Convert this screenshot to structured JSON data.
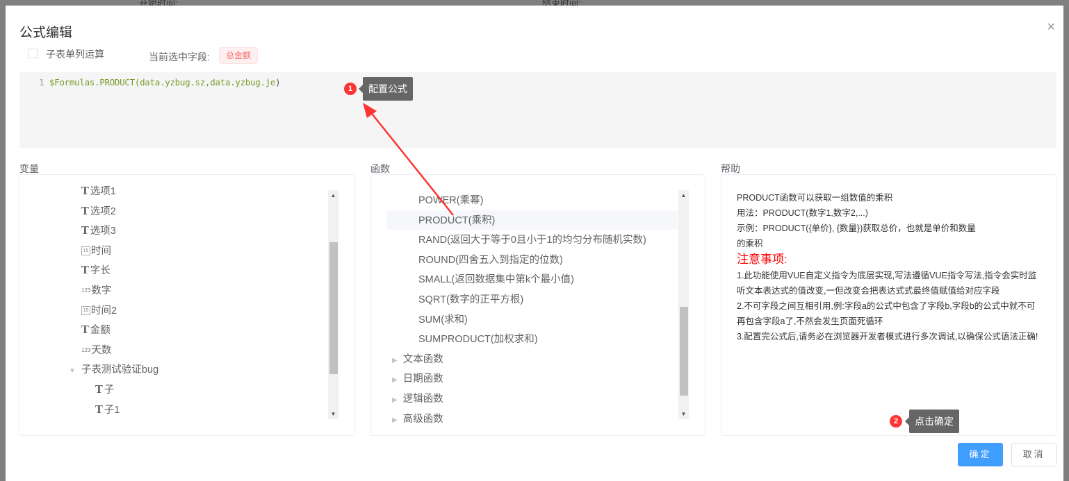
{
  "background": {
    "start_label": "开始时间:",
    "end_label": "结束时间:"
  },
  "dialog": {
    "title": "公式编辑",
    "close": "×",
    "subtable_checkbox_label": "子表单列运算",
    "current_field_label": "当前选中字段:",
    "current_field": "总金额",
    "editor": {
      "line": "1",
      "formula_prefix": "$Formulas",
      "formula_fn": ".PRODUCT(",
      "formula_args": "data.yzbug.sz,data.yzbug.je",
      "formula_end": ")"
    },
    "variables": {
      "label": "变量",
      "items": [
        {
          "icon": "T",
          "label": "选项1"
        },
        {
          "icon": "T",
          "label": "选项2"
        },
        {
          "icon": "T",
          "label": "选项3"
        },
        {
          "icon": "15",
          "label": "时间"
        },
        {
          "icon": "T",
          "label": "字长"
        },
        {
          "icon": "123",
          "label": "数字"
        },
        {
          "icon": "15",
          "label": "时间2"
        },
        {
          "icon": "T",
          "label": "金额"
        },
        {
          "icon": "123",
          "label": "天数"
        }
      ],
      "group": "子表测试验证bug",
      "children": [
        {
          "icon": "T",
          "label": "子"
        },
        {
          "icon": "T",
          "label": "子1"
        }
      ]
    },
    "functions": {
      "label": "函数",
      "items": [
        "POWER(乘幂)",
        "PRODUCT(乘积)",
        "RAND(返回大于等于0且小于1的均匀分布随机实数)",
        "ROUND(四舍五入到指定的位数)",
        "SMALL(返回数据集中第k个最小值)",
        "SQRT(数字的正平方根)",
        "SUM(求和)",
        "SUMPRODUCT(加权求和)"
      ],
      "selected": "PRODUCT(乘积)",
      "groups": [
        "文本函数",
        "日期函数",
        "逻辑函数",
        "高级函数"
      ]
    },
    "help": {
      "label": "帮助",
      "lines": [
        "PRODUCT函数可以获取一组数值的乘积",
        "用法：PRODUCT(数字1,数字2,...)",
        "示例：PRODUCT({单价}, {数量})获取总价，也就是单价和数量的乘积"
      ],
      "note_title": "注意事项:",
      "notes": [
        "1.此功能使用VUE自定义指令为底层实现,写法遵循VUE指令写法,指令会实时监听文本表达式的值改变,一但改变会把表达式式最终值赋值给对应字段",
        "2.不可字段之间互相引用,例:字段a的公式中包含了字段b,字段b的公式中就不可再包含字段a了,不然会发生页面死循环",
        "3.配置完公式后,请务必在浏览器开发者模式进行多次调试,以确保公式语法正确!"
      ]
    },
    "confirm": "确定",
    "cancel": "取消"
  },
  "annotations": [
    {
      "number": "1",
      "text": "配置公式"
    },
    {
      "number": "2",
      "text": "点击确定"
    }
  ],
  "colors": {
    "primary": "#409eff",
    "annotation": "#ff3333",
    "tag": "#f56c6c"
  }
}
